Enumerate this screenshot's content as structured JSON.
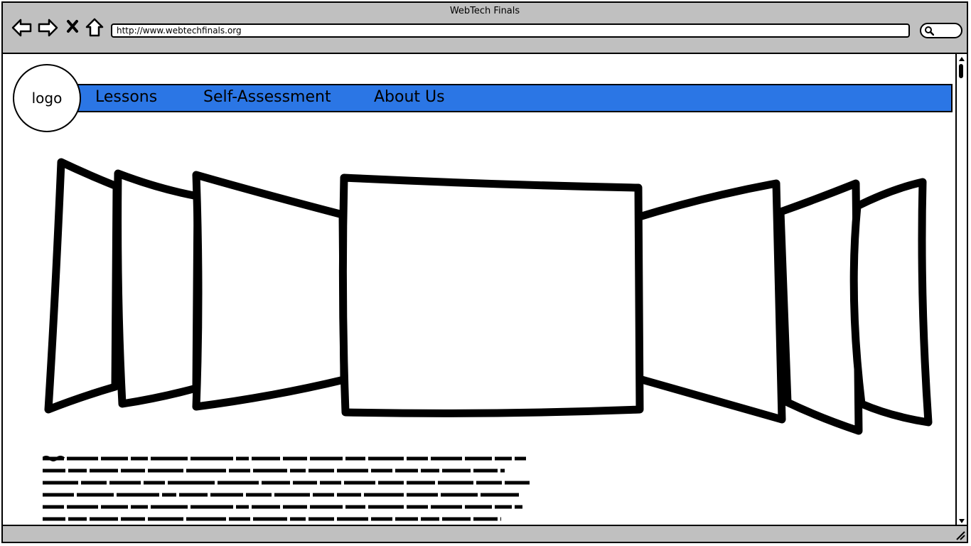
{
  "window": {
    "title": "WebTech Finals"
  },
  "browser": {
    "url": "http://www.webtechfinals.org",
    "nav_icons": [
      "back-arrow-icon",
      "forward-arrow-icon",
      "close-icon",
      "home-icon"
    ],
    "search_icon": "search-icon"
  },
  "header": {
    "logo_label": "logo",
    "nav": {
      "lessons": "Lessons",
      "self_assessment": "Self-Assessment",
      "about_us": "About Us"
    }
  },
  "carousel": {
    "slides": 7,
    "active_slide": 4
  },
  "colors": {
    "navbar": "#2b76e5",
    "chrome": "#c0c0c0"
  }
}
